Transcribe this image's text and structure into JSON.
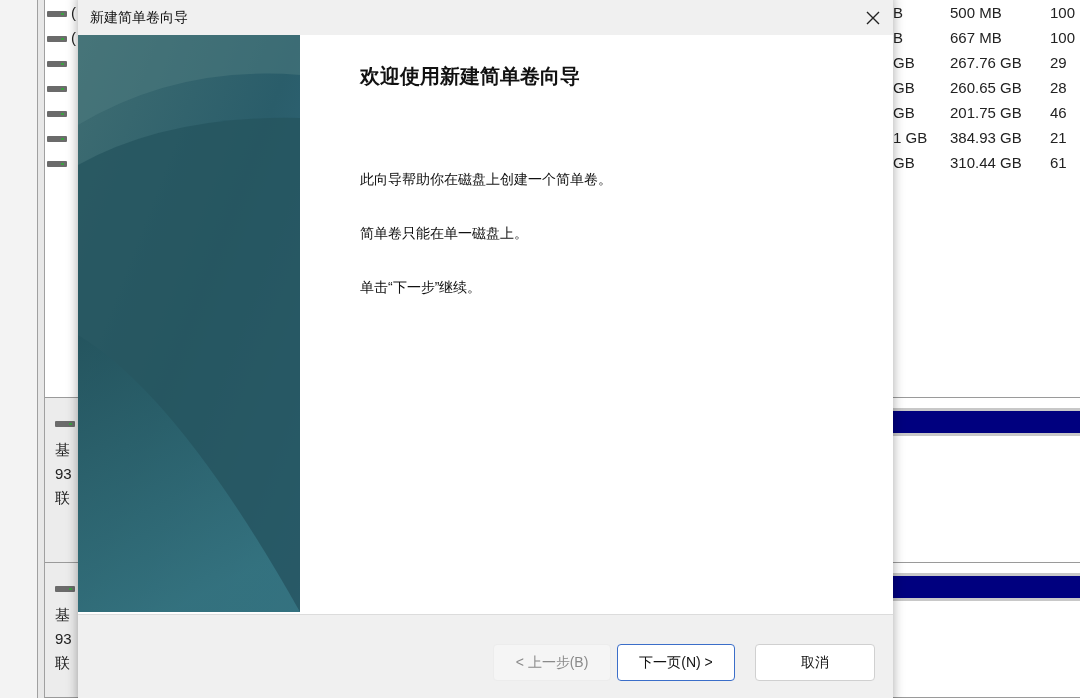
{
  "background_window": {
    "volumes": [
      {
        "name": "(",
        "capacity": "B",
        "free": "500 MB",
        "percent": "100"
      },
      {
        "name": "(",
        "capacity": "B",
        "free": "667 MB",
        "percent": "100"
      },
      {
        "capacity": "GB",
        "free": "267.76 GB",
        "percent": "29"
      },
      {
        "capacity": "GB",
        "free": "260.65 GB",
        "percent": "28"
      },
      {
        "capacity": "GB",
        "free": "201.75 GB",
        "percent": "46"
      },
      {
        "capacity": "1 GB",
        "free": "384.93 GB",
        "percent": "21"
      },
      {
        "capacity": "GB",
        "free": "310.44 GB",
        "percent": "61"
      }
    ],
    "disks": [
      {
        "type": "基",
        "size": "93",
        "status": "联"
      },
      {
        "type": "基",
        "size": "93",
        "status": "联"
      }
    ]
  },
  "dialog": {
    "title": "新建简单卷向导",
    "heading": "欢迎使用新建简单卷向导",
    "paragraphs": [
      "此向导帮助你在磁盘上创建一个简单卷。",
      "简单卷只能在单一磁盘上。",
      "单击“下一步”继续。"
    ],
    "buttons": [
      {
        "label": "< 上一步(B)",
        "disabled": true,
        "default": false
      },
      {
        "label": "下一页(N) >",
        "disabled": false,
        "default": true
      },
      {
        "label": "取消",
        "disabled": false,
        "default": false
      }
    ]
  }
}
